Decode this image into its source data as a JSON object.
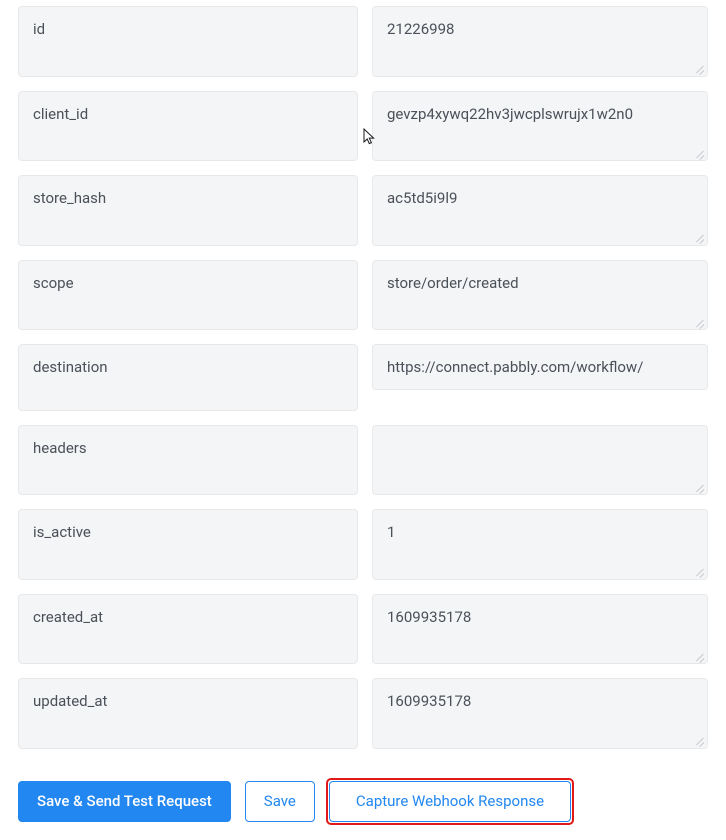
{
  "fields": [
    {
      "key": "id",
      "value": "21226998"
    },
    {
      "key": "client_id",
      "value": "gevzp4xywq22hv3jwcplswrujx1w2n0"
    },
    {
      "key": "store_hash",
      "value": "ac5td5i9l9"
    },
    {
      "key": "scope",
      "value": "store/order/created"
    },
    {
      "key": "destination",
      "value": "https://connect.pabbly.com/workflow/",
      "scroll": true
    },
    {
      "key": "headers",
      "value": ""
    },
    {
      "key": "is_active",
      "value": "1"
    },
    {
      "key": "created_at",
      "value": "1609935178"
    },
    {
      "key": "updated_at",
      "value": "1609935178"
    }
  ],
  "buttons": {
    "primary": "Save & Send Test Request",
    "save": "Save",
    "capture": "Capture Webhook Response"
  }
}
